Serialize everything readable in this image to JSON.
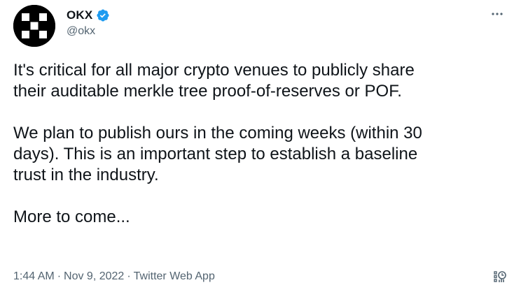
{
  "author": {
    "display_name": "OKX",
    "handle": "@okx",
    "verified": true,
    "avatar_icon": "okx-logo-icon",
    "verified_color": "#1d9bf0"
  },
  "tweet": {
    "lines": [
      "It's critical for all major crypto venues to publicly share",
      "their auditable merkle tree proof-of-reserves or POF.",
      "We plan to publish ours in the coming weeks (within 30",
      "days). This is an important step to establish a baseline",
      "trust in the industry.",
      "More to come..."
    ]
  },
  "meta": {
    "time": "1:44 AM",
    "date": "Nov 9, 2022",
    "source": "Twitter Web App",
    "separator": "·"
  },
  "icons": {
    "more": "more-horizontal-icon",
    "analytics": "analytics-icon"
  },
  "colors": {
    "text": "#0f1419",
    "secondary": "#536471",
    "verified": "#1d9bf0"
  }
}
